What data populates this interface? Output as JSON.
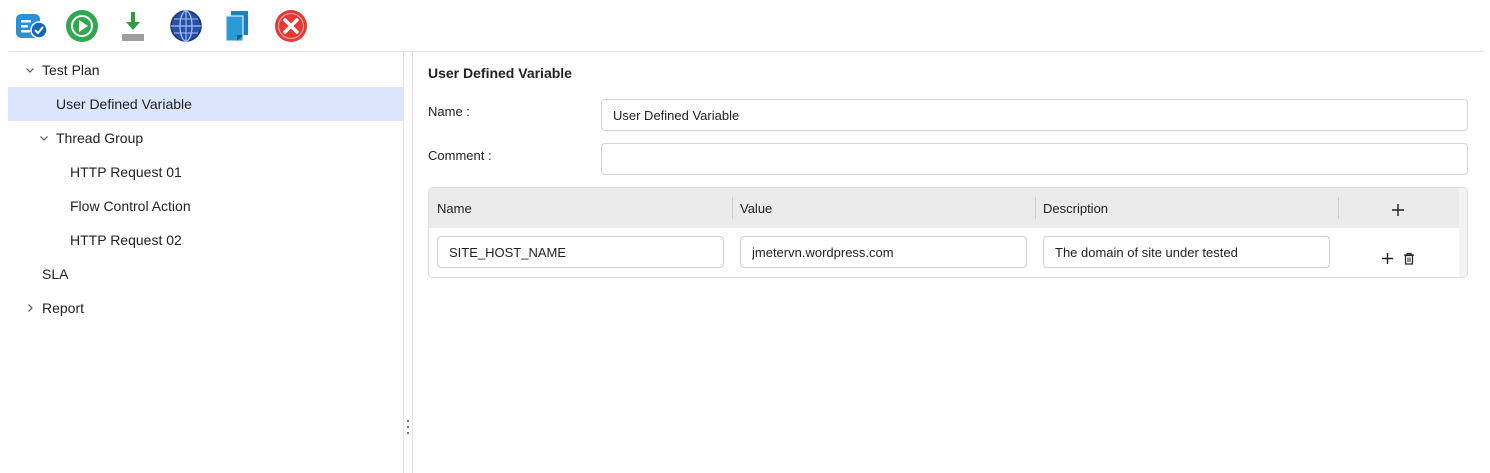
{
  "toolbar": {
    "buttons": [
      {
        "name": "test-plan-check-icon",
        "color": "#2b8fd8"
      },
      {
        "name": "run-icon",
        "color": "#2fa84f"
      },
      {
        "name": "download-icon",
        "color": "#2e9e3a"
      },
      {
        "name": "globe-icon",
        "color": "#2a4fa5"
      },
      {
        "name": "copy-icon",
        "color": "#1f7fb8"
      },
      {
        "name": "close-icon",
        "color": "#e53935"
      }
    ]
  },
  "tree": {
    "items": [
      {
        "label": "Test Plan",
        "expanded": true
      },
      {
        "label": "User Defined Variable",
        "selected": true
      },
      {
        "label": "Thread Group",
        "expanded": true
      },
      {
        "label": "HTTP Request 01"
      },
      {
        "label": "Flow Control Action"
      },
      {
        "label": "HTTP Request 02"
      },
      {
        "label": "SLA"
      },
      {
        "label": "Report",
        "expanded": false
      }
    ]
  },
  "panel": {
    "title": "User Defined Variable",
    "name_label": "Name :",
    "name_value": "User Defined Variable",
    "comment_label": "Comment :",
    "comment_value": ""
  },
  "variables": {
    "columns": [
      "Name",
      "Value",
      "Description"
    ],
    "rows": [
      {
        "name": "SITE_HOST_NAME",
        "value": "jmetervn.wordpress.com",
        "description": "The domain of site under tested"
      }
    ]
  },
  "colors": {
    "selected_row": "#dbe6fd",
    "grid_header": "#ebebeb"
  }
}
